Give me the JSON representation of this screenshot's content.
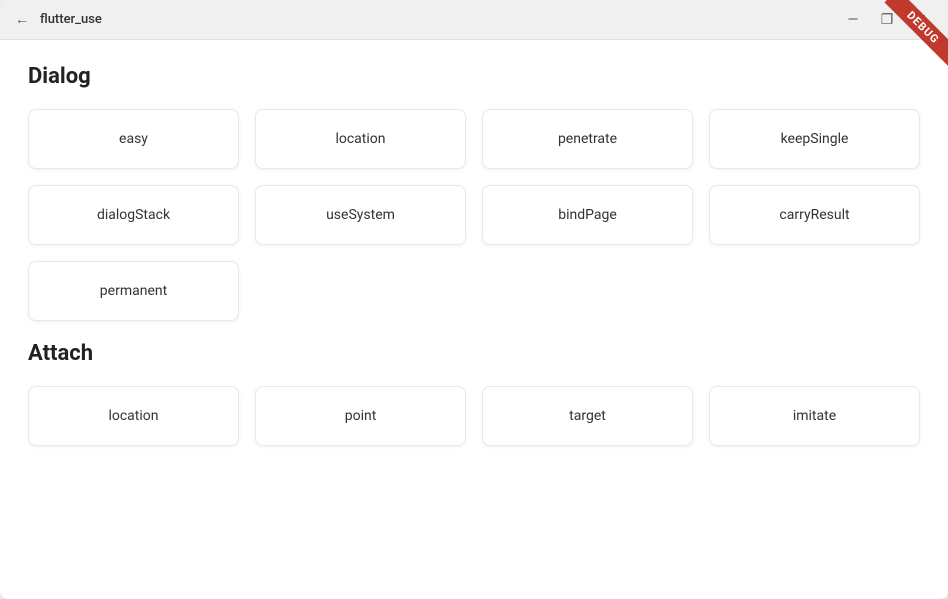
{
  "window": {
    "title": "flutter_use"
  },
  "debug_ribbon": "DEBUG",
  "sections": [
    {
      "id": "dialog",
      "title": "Dialog",
      "rows": [
        [
          "easy",
          "location",
          "penetrate",
          "keepSingle"
        ],
        [
          "dialogStack",
          "useSystem",
          "bindPage",
          "carryResult"
        ],
        [
          "permanent"
        ]
      ]
    },
    {
      "id": "attach",
      "title": "Attach",
      "rows": [
        [
          "location",
          "point",
          "target",
          "imitate"
        ]
      ]
    }
  ],
  "titlebar": {
    "back_label": "←",
    "minimize_label": "—",
    "maximize_label": "❐",
    "close_label": "✕"
  }
}
